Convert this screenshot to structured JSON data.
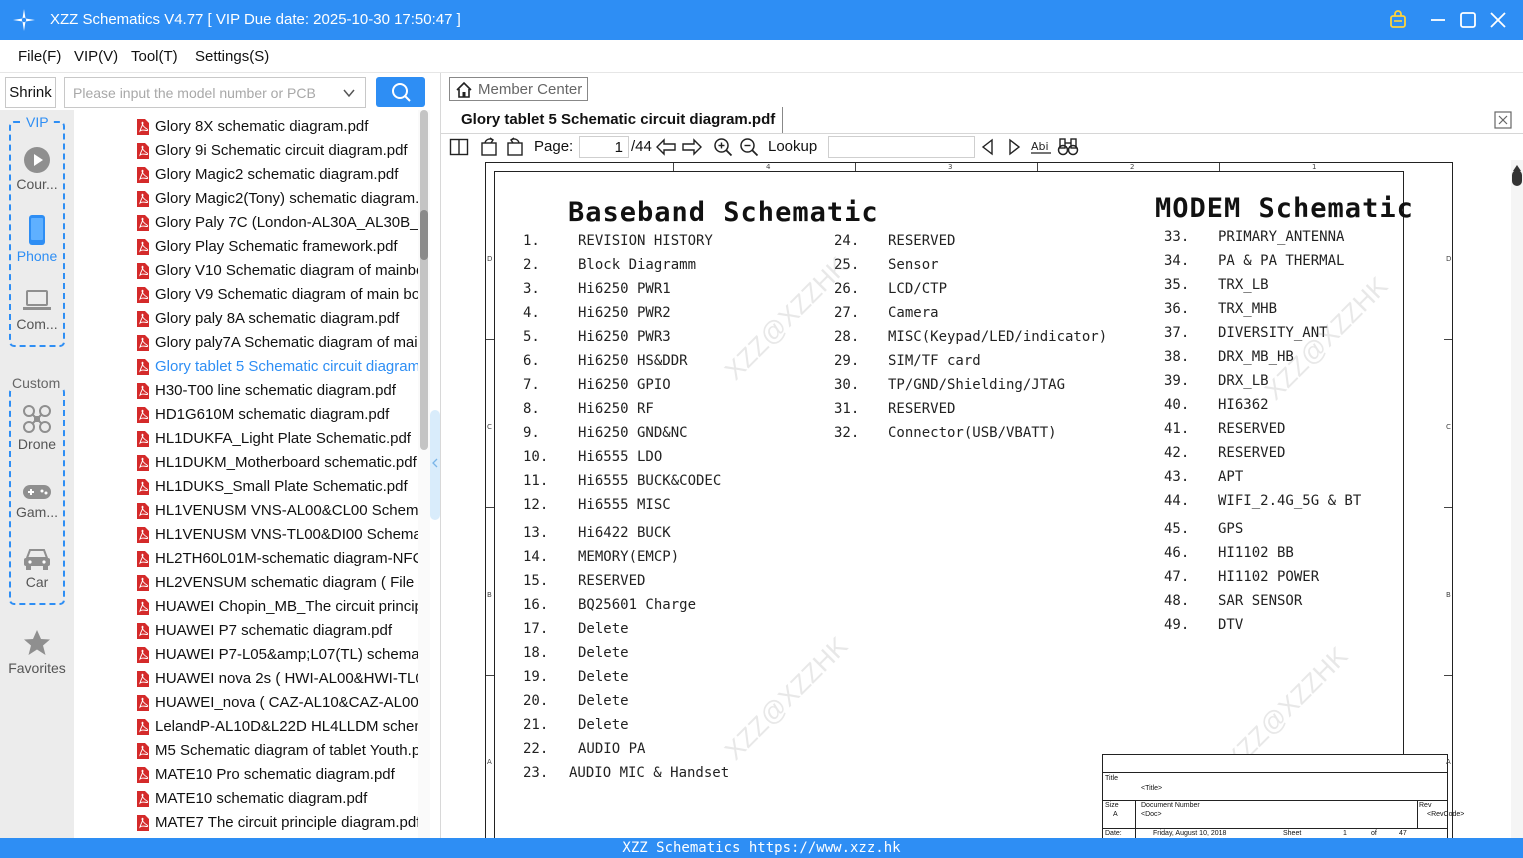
{
  "app": {
    "title": "XZZ Schematics V4.77 [ VIP Due date: 2025-10-30 17:50:47 ]"
  },
  "menu": [
    "File(F)",
    "VIP(V)",
    "Tool(T)",
    "Settings(S)"
  ],
  "search": {
    "shrink_label": "Shrink",
    "placeholder": "Please input the model number or PCB",
    "value": ""
  },
  "sidebar": {
    "vip_group_title": "VIP",
    "custom_group_title": "Custom",
    "items": [
      {
        "label": "Cour...",
        "icon": "play-icon"
      },
      {
        "label": "Phone",
        "icon": "phone-icon",
        "active": true
      },
      {
        "label": "Com...",
        "icon": "laptop-icon"
      },
      {
        "label": "Drone",
        "icon": "drone-icon"
      },
      {
        "label": "Gam...",
        "icon": "gamepad-icon"
      },
      {
        "label": "Car",
        "icon": "car-icon"
      },
      {
        "label": "Favorites",
        "icon": "star-icon"
      }
    ]
  },
  "files": [
    "Glory 8X schematic diagram.pdf",
    "Glory 9i Schematic circuit diagram.pdf",
    "Glory Magic2 schematic diagram.pdf",
    "Glory Magic2(Tony) schematic diagram.pdf",
    "Glory Paly 7C (London-AL30A_AL30B_AL00) schematic.pdf",
    "Glory Play Schematic framework.pdf",
    "Glory V10 Schematic diagram of mainboard.pdf",
    "Glory V9 Schematic diagram of main board.pdf",
    "Glory paly 8A schematic diagram.pdf",
    "Glory paly7A Schematic diagram of mainboard.pdf",
    "Glory tablet 5 Schematic circuit diagram.pdf",
    "H30-T00 line schematic diagram.pdf",
    "HD1G610M schematic diagram.pdf",
    "HL1DUKFA_Light Plate Schematic.pdf",
    "HL1DUKM_Motherboard schematic.pdf",
    "HL1DUKS_Small Plate Schematic.pdf",
    "HL1VENUSM VNS-AL00&CL00 Schematic.pdf",
    "HL1VENUSM VNS-TL00&DI00 Schematic.pdf",
    "HL2TH60L01M-schematic diagram-NFC.pdf",
    "HL2VENSUM schematic diagram ( File ).pdf",
    "HUAWEI Chopin_MB_The circuit principle.pdf",
    "HUAWEI P7 schematic diagram.pdf",
    "HUAWEI P7-L05&amp;L07(TL) schematic.pdf",
    "HUAWEI nova 2s ( HWI-AL00&HWI-TL00 ).pdf",
    "HUAWEI_nova ( CAZ-AL10&CAZ-AL00 ).pdf",
    "LelandP-AL10D&L22D HL4LLDM schematic.pdf",
    "M5 Schematic diagram of tablet Youth.pdf",
    "MATE10 Pro schematic diagram.pdf",
    "MATE10 schematic diagram.pdf",
    "MATE7 The circuit principle diagram.pdf"
  ],
  "active_file_index": 10,
  "viewer": {
    "member_center": "Member Center",
    "tab_title": "Glory tablet 5 Schematic circuit diagram.pdf",
    "page_label": "Page:",
    "page_current": "1",
    "page_total": "/44",
    "lookup_label": "Lookup",
    "lookup_value": ""
  },
  "schematic": {
    "left_title": "Baseband Schematic",
    "right_title": "MODEM Schematic",
    "col1": [
      [
        "1.",
        "REVISION HISTORY"
      ],
      [
        "2.",
        "Block Diagramm"
      ],
      [
        "3.",
        "Hi6250 PWR1"
      ],
      [
        "4.",
        "Hi6250 PWR2"
      ],
      [
        "5.",
        "Hi6250 PWR3"
      ],
      [
        "6.",
        "Hi6250 HS&DDR"
      ],
      [
        "7.",
        "Hi6250 GPIO"
      ],
      [
        "8.",
        "Hi6250 RF"
      ],
      [
        "9.",
        "Hi6250 GND&NC"
      ],
      [
        "10.",
        "Hi6555 LDO"
      ],
      [
        "11.",
        "Hi6555 BUCK&CODEC"
      ],
      [
        "12.",
        "Hi6555 MISC"
      ],
      [
        "13.",
        "Hi6422 BUCK"
      ],
      [
        "14.",
        "MEMORY(EMCP)"
      ],
      [
        "15.",
        "RESERVED"
      ],
      [
        "16.",
        "BQ25601 Charge"
      ],
      [
        "17.",
        "Delete"
      ],
      [
        "18.",
        "Delete"
      ],
      [
        "19.",
        "Delete"
      ],
      [
        "20.",
        "Delete"
      ],
      [
        "21.",
        "Delete"
      ],
      [
        "22.",
        "AUDIO PA"
      ],
      [
        "23.",
        "AUDIO MIC & Handset"
      ]
    ],
    "col2": [
      [
        "24.",
        "RESERVED"
      ],
      [
        "25.",
        "Sensor"
      ],
      [
        "26.",
        "LCD/CTP"
      ],
      [
        "27.",
        "Camera"
      ],
      [
        "28.",
        "MISC(Keypad/LED/indicator)"
      ],
      [
        "29.",
        "SIM/TF card"
      ],
      [
        "30.",
        "TP/GND/Shielding/JTAG"
      ],
      [
        "31.",
        "RESERVED"
      ],
      [
        "32.",
        "Connector(USB/VBATT)"
      ]
    ],
    "col3": [
      [
        "33.",
        "PRIMARY_ANTENNA"
      ],
      [
        "34.",
        "PA & PA THERMAL"
      ],
      [
        "35.",
        "TRX_LB"
      ],
      [
        "36.",
        "TRX_MHB"
      ],
      [
        "37.",
        "DIVERSITY_ANT"
      ],
      [
        "38.",
        "DRX_MB_HB"
      ],
      [
        "39.",
        "DRX_LB"
      ],
      [
        "40.",
        "HI6362"
      ],
      [
        "41.",
        "RESERVED"
      ],
      [
        "42.",
        "RESERVED"
      ],
      [
        "43.",
        "APT"
      ],
      [
        "44.",
        "WIFI_2.4G_5G & BT"
      ],
      [
        "45.",
        "GPS"
      ],
      [
        "46.",
        "HI1102 BB"
      ],
      [
        "47.",
        "HI1102 POWER"
      ],
      [
        "48.",
        "SAR SENSOR"
      ],
      [
        "49.",
        "DTV"
      ]
    ],
    "zone_top": [
      "4",
      "3",
      "2",
      "1"
    ],
    "zone_side": [
      "D",
      "C",
      "B",
      "A"
    ],
    "watermark": "XZZ@XZZHK",
    "title_block": {
      "title_label": "Title",
      "title_value": "<Title>",
      "size_label": "Size",
      "size_value": "A",
      "docnum_label": "Document Number",
      "docnum_value": "<Doc>",
      "rev_label": "Rev",
      "rev_value": "<RevCode>",
      "date_label": "Date:",
      "date_value": "Friday, August 10, 2018",
      "sheet_label": "Sheet",
      "sheet_value": "1",
      "of_label": "of",
      "of_value": "47"
    }
  },
  "statusbar": "XZZ Schematics https://www.xzz.hk",
  "colors": {
    "accent": "#2e8ef4",
    "pdf_red": "#d42a2a",
    "sidebar_bg": "#ececec"
  }
}
